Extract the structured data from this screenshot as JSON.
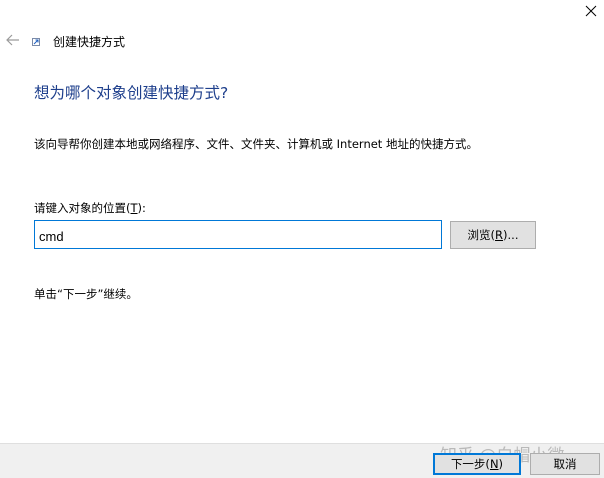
{
  "window": {
    "title": "创建快捷方式",
    "back_icon": "back-arrow-icon",
    "close_icon": "close-icon",
    "app_icon": "shortcut-icon"
  },
  "main": {
    "heading": "想为哪个对象创建快捷方式?",
    "description": "该向导帮你创建本地或网络程序、文件、文件夹、计算机或 Internet 地址的快捷方式。",
    "location_label": "请键入对象的位置(",
    "location_label_key": "T",
    "location_label_end": "):",
    "location_value": "cmd",
    "browse_label": "浏览(",
    "browse_key": "R",
    "browse_label_end": ")...",
    "hint": "单击“下一步”继续。"
  },
  "footer": {
    "next_label": "下一步(",
    "next_key": "N",
    "next_label_end": ")",
    "cancel_label": "取消",
    "watermark": "知乎 @白帽小微"
  },
  "colors": {
    "heading": "#1e3f8c",
    "focus_border": "#0078d7",
    "button_bg": "#e1e1e1",
    "footer_bg": "#f0f0f0"
  }
}
